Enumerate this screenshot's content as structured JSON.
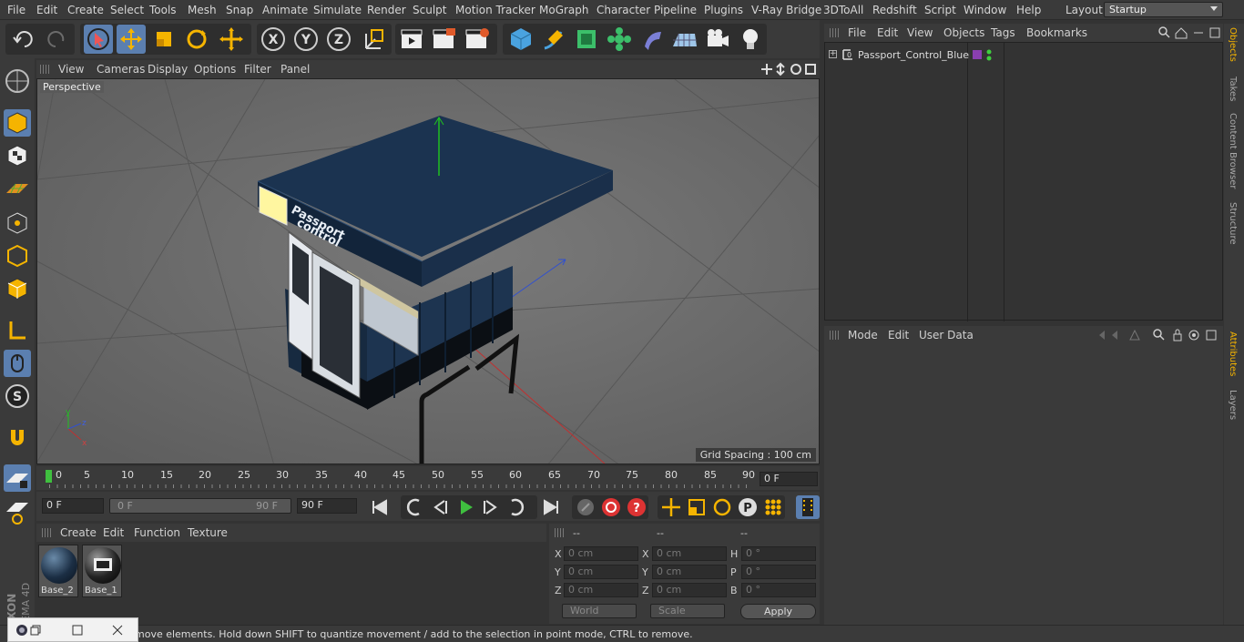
{
  "menubar": {
    "items": [
      "File",
      "Edit",
      "Create",
      "Select",
      "Tools",
      "Mesh",
      "Snap",
      "Animate",
      "Simulate",
      "Render",
      "Sculpt",
      "Motion Tracker",
      "MoGraph",
      "Character",
      "Pipeline",
      "Plugins",
      "V-Ray Bridge",
      "3DToAll",
      "Redshift",
      "Script",
      "Window",
      "Help"
    ],
    "layout_label": "Layout:",
    "layout_value": "Startup"
  },
  "viewport": {
    "menu": [
      "View",
      "Cameras",
      "Display",
      "Options",
      "Filter",
      "Panel"
    ],
    "label": "Perspective",
    "grid_spacing": "Grid Spacing : 100 cm",
    "sign_line1": "Passport",
    "sign_line2": "control"
  },
  "timeline": {
    "ticks": [
      "0",
      "5",
      "10",
      "15",
      "20",
      "25",
      "30",
      "35",
      "40",
      "45",
      "50",
      "55",
      "60",
      "65",
      "70",
      "75",
      "80",
      "85",
      "90"
    ],
    "current_frame": "0 F"
  },
  "playback": {
    "start": "0 F",
    "range_start": "0 F",
    "range_end": "90 F",
    "end": "90 F"
  },
  "materials": {
    "menu": [
      "Create",
      "Edit",
      "Function",
      "Texture"
    ],
    "items": [
      {
        "label": "Base_2"
      },
      {
        "label": "Base_1"
      }
    ]
  },
  "coords": {
    "headers": [
      "--",
      "--",
      "--"
    ],
    "rows": [
      {
        "a": "X",
        "av": "0 cm",
        "b": "X",
        "bv": "0 cm",
        "c": "H",
        "cv": "0 °"
      },
      {
        "a": "Y",
        "av": "0 cm",
        "b": "Y",
        "bv": "0 cm",
        "c": "P",
        "cv": "0 °"
      },
      {
        "a": "Z",
        "av": "0 cm",
        "b": "Z",
        "bv": "0 cm",
        "c": "B",
        "cv": "0 °"
      }
    ],
    "space": "World",
    "mode": "Scale",
    "apply": "Apply"
  },
  "objects": {
    "menu": [
      "File",
      "Edit",
      "View",
      "Objects",
      "Tags",
      "Bookmarks"
    ],
    "item": "Passport_Control_Blue"
  },
  "attributes": {
    "menu": [
      "Mode",
      "Edit",
      "User Data"
    ]
  },
  "side_tabs": [
    "Objects",
    "Takes",
    "Content Browser",
    "Structure"
  ],
  "attr_side_tabs": [
    "Attributes",
    "Layers"
  ],
  "status": "move elements. Hold down SHIFT to quantize movement / add to the selection in point mode, CTRL to remove.",
  "branding": {
    "maxon": "MAXON",
    "product": "CINEMA 4D"
  },
  "colors": {
    "accent": "#5a8fd6",
    "selected_tool": "#5b7fb0",
    "play_green": "#3fbf3f"
  }
}
